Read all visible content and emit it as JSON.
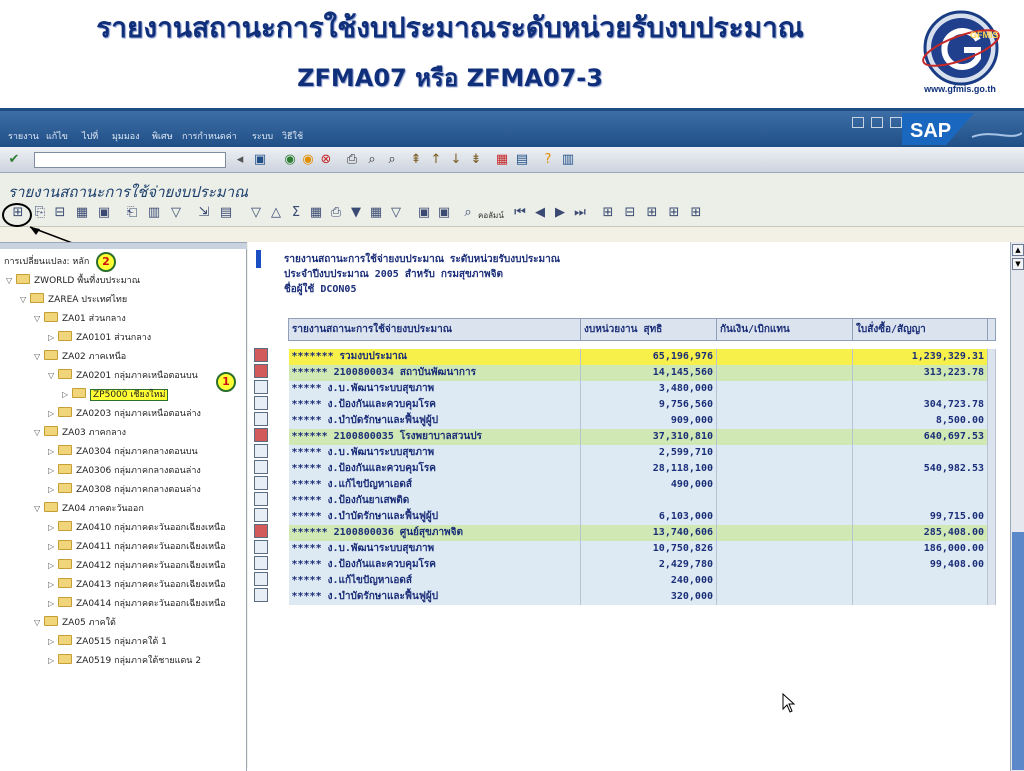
{
  "slide": {
    "title_line1": "รายงานสถานะการใช้งบประมาณระดับหน่วยรับงบประมาณ",
    "title_line2": "ZFMA07 หรือ ZFMA07-3",
    "logo_text": "GFMIS",
    "logo_url": "www.gfmis.go.th"
  },
  "menubar": {
    "items": [
      "รายงาน",
      "แก้ไข",
      "ไปที่",
      "มุมมอง",
      "พิเศษ",
      "การกำหนดค่า",
      "ระบบ",
      "วิธีใช้"
    ],
    "sap_logo": "SAP"
  },
  "screen": {
    "title": "รายงานสถานะการใช้จ่ายงบประมาณ",
    "toolbar_column_label": "คอลัมน์"
  },
  "tree": {
    "header": "การเปลี่ยนแปลง: หลัก",
    "nodes": [
      {
        "label": "ZWORLD พื้นที่งบประมาณ",
        "level": 0,
        "state": "open"
      },
      {
        "label": "ZAREA ประเทศไทย",
        "level": 1,
        "state": "open"
      },
      {
        "label": "ZA01 ส่วนกลาง",
        "level": 2,
        "state": "open"
      },
      {
        "label": "ZA0101 ส่วนกลาง",
        "level": 3,
        "state": "closed"
      },
      {
        "label": "ZA02 ภาคเหนือ",
        "level": 2,
        "state": "open"
      },
      {
        "label": "ZA0201 กลุ่มภาคเหนือตอนบน",
        "level": 3,
        "state": "open"
      },
      {
        "label": "ZP5000 เชียงใหม่",
        "level": 4,
        "state": "closed",
        "selected": true
      },
      {
        "label": "ZA0203 กลุ่มภาคเหนือตอนล่าง",
        "level": 3,
        "state": "closed"
      },
      {
        "label": "ZA03 ภาคกลาง",
        "level": 2,
        "state": "open"
      },
      {
        "label": "ZA0304 กลุ่มภาคกลางตอนบน",
        "level": 3,
        "state": "closed"
      },
      {
        "label": "ZA0306 กลุ่มภาคกลางตอนล่าง",
        "level": 3,
        "state": "closed"
      },
      {
        "label": "ZA0308 กลุ่มภาคกลางตอนล่าง",
        "level": 3,
        "state": "closed"
      },
      {
        "label": "ZA04 ภาคตะวันออก",
        "level": 2,
        "state": "open"
      },
      {
        "label": "ZA0410 กลุ่มภาคตะวันออกเฉียงเหนือ",
        "level": 3,
        "state": "closed"
      },
      {
        "label": "ZA0411 กลุ่มภาคตะวันออกเฉียงเหนือ",
        "level": 3,
        "state": "closed"
      },
      {
        "label": "ZA0412 กลุ่มภาคตะวันออกเฉียงเหนือ",
        "level": 3,
        "state": "closed"
      },
      {
        "label": "ZA0413 กลุ่มภาคตะวันออกเฉียงเหนือ",
        "level": 3,
        "state": "closed"
      },
      {
        "label": "ZA0414 กลุ่มภาคตะวันออกเฉียงเหนือ",
        "level": 3,
        "state": "closed"
      },
      {
        "label": "ZA05 ภาคใต้",
        "level": 2,
        "state": "open"
      },
      {
        "label": "ZA0515 กลุ่มภาคใต้ 1",
        "level": 3,
        "state": "closed"
      },
      {
        "label": "ZA0519 กลุ่มภาคใต้ชายแดน 2",
        "level": 3,
        "state": "closed"
      }
    ],
    "markers": {
      "selected": "1",
      "toolbar": "2"
    }
  },
  "report": {
    "header_lines": [
      "รายงานสถานะการใช้จ่ายงบประมาณ ระดับหน่วยรับงบประมาณ",
      "ประจำปีงบประมาณ 2005 สำหรับ กรมสุขภาพจิต",
      "ชื่อผู้ใช้ DCON05"
    ],
    "columns": [
      "รายงานสถานะการใช้จ่ายงบประมาณ",
      "งบหน่วยงาน สุทธิ",
      "กันเงิน/เบิกแทน",
      "ใบสั่งซื้อ/สัญญา"
    ],
    "rows": [
      {
        "label": "******* รวมงบประมาณ",
        "c2": "65,196,976",
        "c3": "",
        "c4": "1,239,329.31",
        "level": 7
      },
      {
        "label": "******   2100800034  สถาบันพัฒนาการ",
        "c2": "14,145,560",
        "c3": "",
        "c4": "313,223.78",
        "level": 6
      },
      {
        "label": "*****      ง.บ.พัฒนาระบบสุขภาพ",
        "c2": "3,480,000",
        "c3": "",
        "c4": "",
        "level": 5
      },
      {
        "label": "*****      ง.ป้องกันและควบคุมโรค",
        "c2": "9,756,560",
        "c3": "",
        "c4": "304,723.78",
        "level": 5
      },
      {
        "label": "*****      ง.บำบัดรักษาและฟื้นฟูผู้ป",
        "c2": "909,000",
        "c3": "",
        "c4": "8,500.00",
        "level": 5
      },
      {
        "label": "******   2100800035  โรงพยาบาลสวนปร",
        "c2": "37,310,810",
        "c3": "",
        "c4": "640,697.53",
        "level": 6
      },
      {
        "label": "*****      ง.บ.พัฒนาระบบสุขภาพ",
        "c2": "2,599,710",
        "c3": "",
        "c4": "",
        "level": 5
      },
      {
        "label": "*****      ง.ป้องกันและควบคุมโรค",
        "c2": "28,118,100",
        "c3": "",
        "c4": "540,982.53",
        "level": 5
      },
      {
        "label": "*****      ง.แก้ไขปัญหาเอดส์",
        "c2": "490,000",
        "c3": "",
        "c4": "",
        "level": 5
      },
      {
        "label": "*****      ง.ป้องกันยาเสพติด",
        "c2": "",
        "c3": "",
        "c4": "",
        "level": 5
      },
      {
        "label": "*****      ง.บำบัดรักษาและฟื้นฟูผู้ป",
        "c2": "6,103,000",
        "c3": "",
        "c4": "99,715.00",
        "level": 5
      },
      {
        "label": "******   2100800036  ศูนย์สุขภาพจิต",
        "c2": "13,740,606",
        "c3": "",
        "c4": "285,408.00",
        "level": 6
      },
      {
        "label": "*****      ง.บ.พัฒนาระบบสุขภาพ",
        "c2": "10,750,826",
        "c3": "",
        "c4": "186,000.00",
        "level": 5
      },
      {
        "label": "*****      ง.ป้องกันและควบคุมโรค",
        "c2": "2,429,780",
        "c3": "",
        "c4": "99,408.00",
        "level": 5
      },
      {
        "label": "*****      ง.แก้ไขปัญหาเอดส์",
        "c2": "240,000",
        "c3": "",
        "c4": "",
        "level": 5
      },
      {
        "label": "*****      ง.บำบัดรักษาและฟื้นฟูผู้ป",
        "c2": "320,000",
        "c3": "",
        "c4": "",
        "level": 5
      }
    ]
  },
  "colors": {
    "title_blue": "#0f2f7a",
    "sap_blue": "#1f4f86",
    "total_yellow": "#f7f04a",
    "subtotal_green": "#cfe8b4",
    "detail_blue": "#ddeaf4",
    "scroll_thumb": "#5a88c8"
  },
  "icons": {
    "tree_toggle": "hierarchy-icon",
    "marker": "numbered-circle",
    "cursor": "mouse-pointer-icon"
  }
}
